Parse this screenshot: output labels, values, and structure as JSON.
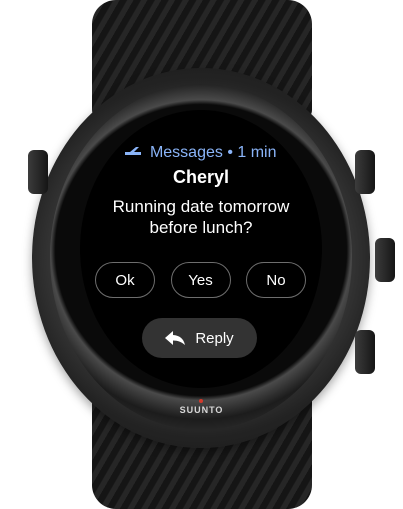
{
  "notification": {
    "app_name": "Messages",
    "separator": "•",
    "time": "1 min",
    "sender": "Cheryl",
    "message_line1": "Running date tomorrow",
    "message_line2": "before lunch?"
  },
  "quick_replies": [
    "Ok",
    "Yes",
    "No"
  ],
  "reply_label": "Reply",
  "brand": "SUUNTO",
  "icons": {
    "app": "messages-icon",
    "reply": "reply-arrow-icon"
  },
  "colors": {
    "accent": "#8ab4f8",
    "screen": "#000000",
    "reply_button": "#333333",
    "brand_dot": "#d33a2c"
  }
}
